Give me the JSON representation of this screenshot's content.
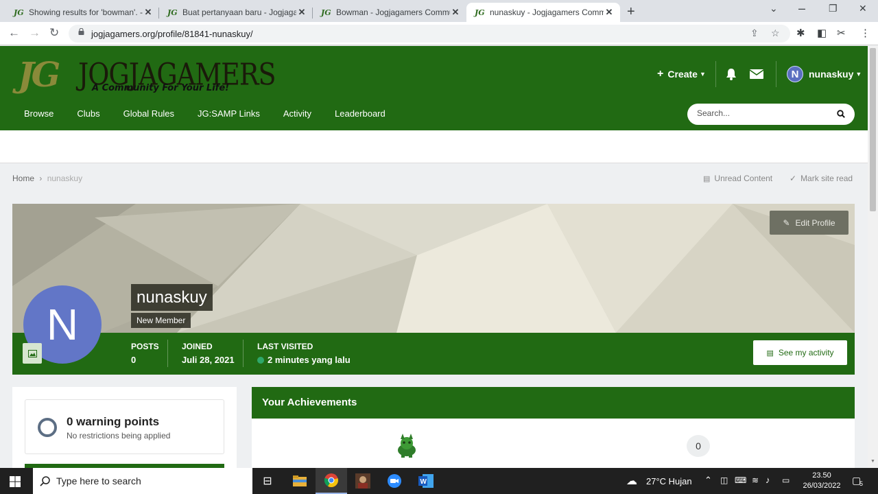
{
  "browser": {
    "tabs": [
      {
        "title": "Showing results for 'bowman'. - J",
        "active": false
      },
      {
        "title": "Buat pertanyaan baru - Jogjagam",
        "active": false
      },
      {
        "title": "Bowman - Jogjagamers Commun",
        "active": false
      },
      {
        "title": "nunaskuy - Jogjagamers Commu",
        "active": true
      }
    ],
    "favicon_text": "JG",
    "url": "jogjagamers.org/profile/81841-nunaskuy/"
  },
  "site": {
    "logo_initials": "JG",
    "logo_name": "JOGJAGAMERS",
    "logo_tagline": "A Community For Your Life!",
    "create_label": "Create",
    "username": "nunaskuy",
    "avatar_letter": "N",
    "nav": [
      "Browse",
      "Clubs",
      "Global Rules",
      "JG:SAMP Links",
      "Activity",
      "Leaderboard"
    ],
    "search_placeholder": "Search..."
  },
  "breadcrumb": {
    "home": "Home",
    "current": "nunaskuy",
    "unread": "Unread Content",
    "mark_read": "Mark site read"
  },
  "profile": {
    "edit_label": "Edit Profile",
    "name": "nunaskuy",
    "rank": "New Member",
    "avatar_letter": "N",
    "stats": [
      {
        "label": "Posts",
        "value": "0"
      },
      {
        "label": "Joined",
        "value": "Juli 28, 2021"
      },
      {
        "label": "Last visited",
        "value": "2 minutes yang lalu"
      }
    ],
    "activity_label": "See my activity"
  },
  "warnings": {
    "title": "0 warning points",
    "subtitle": "No restrictions being applied"
  },
  "achievements": {
    "heading": "Your Achievements",
    "count": "0"
  },
  "taskbar": {
    "search_placeholder": "Type here to search",
    "weather": "27°C  Hujan",
    "time": "23.50",
    "date": "26/03/2022",
    "notification_count": "5"
  },
  "colors": {
    "brand_green": "#216a13",
    "avatar_blue": "#6276c7",
    "online": "#2fa86a"
  }
}
